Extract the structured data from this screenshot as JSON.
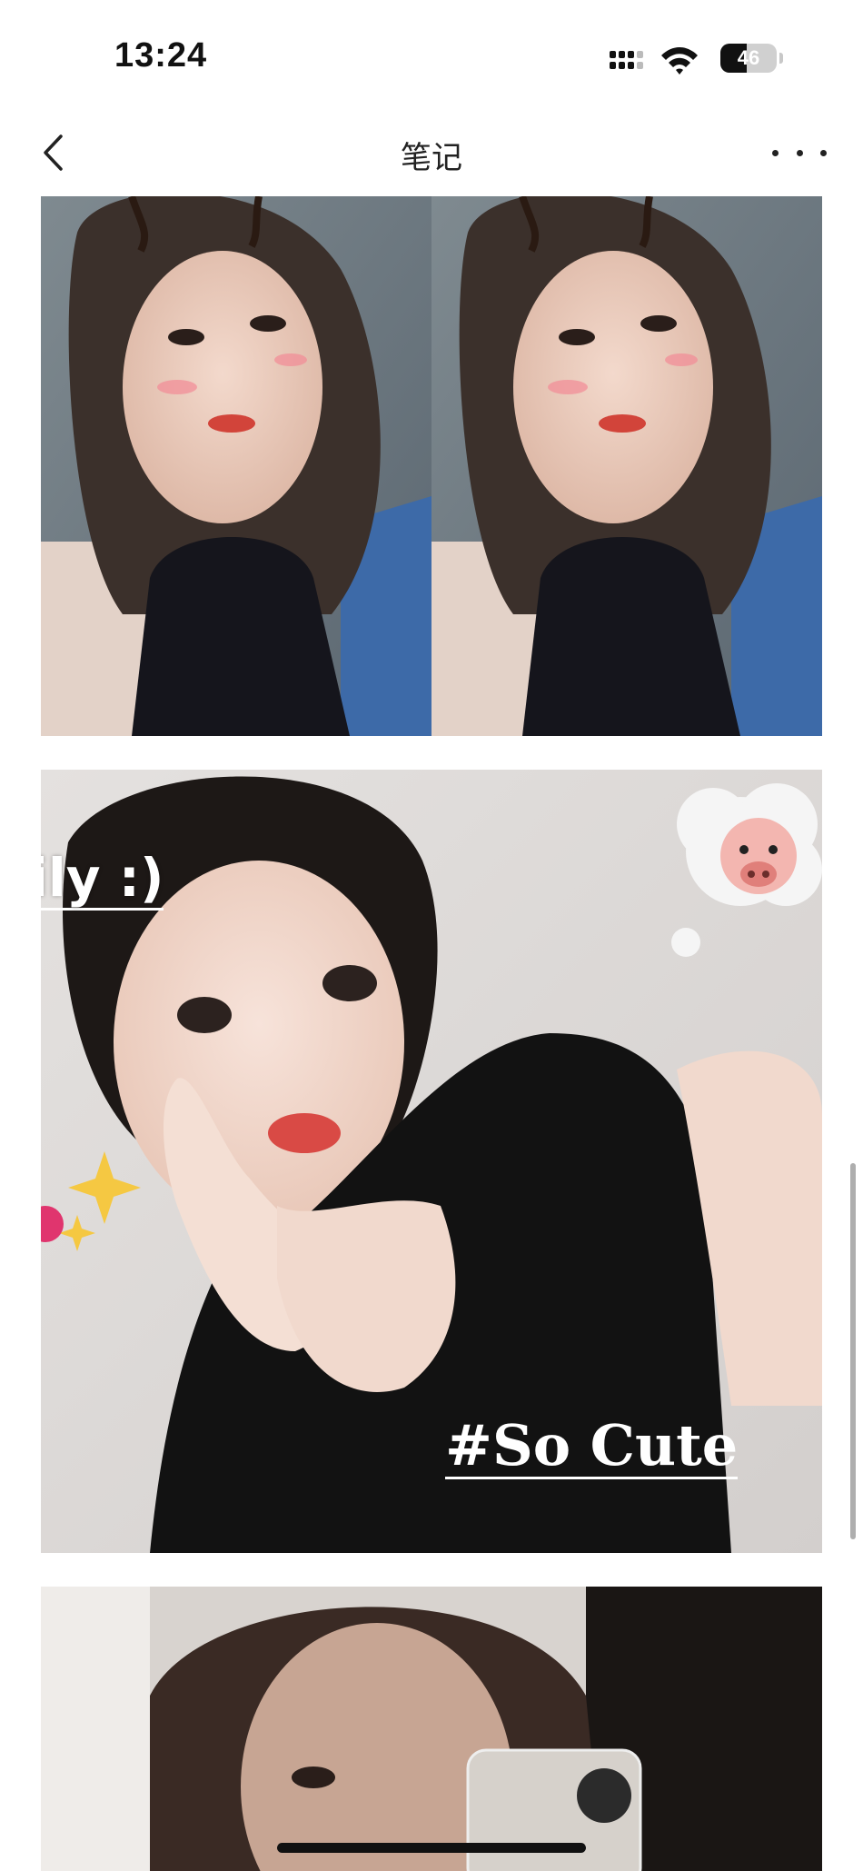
{
  "status_bar": {
    "time": "13:24",
    "battery": "46",
    "battery_level": 0.46,
    "icons": [
      "cellular-signal-icon",
      "wifi-icon",
      "battery-icon"
    ]
  },
  "nav": {
    "title": "笔记",
    "back_icon": "chevron-left-icon",
    "more_icon": "more-dots-icon"
  },
  "photos": {
    "photo_2": {
      "caption_top": "ily :)",
      "caption_bottom": "#So Cute"
    }
  },
  "colors": {
    "background": "#ffffff",
    "text": "#111111"
  }
}
